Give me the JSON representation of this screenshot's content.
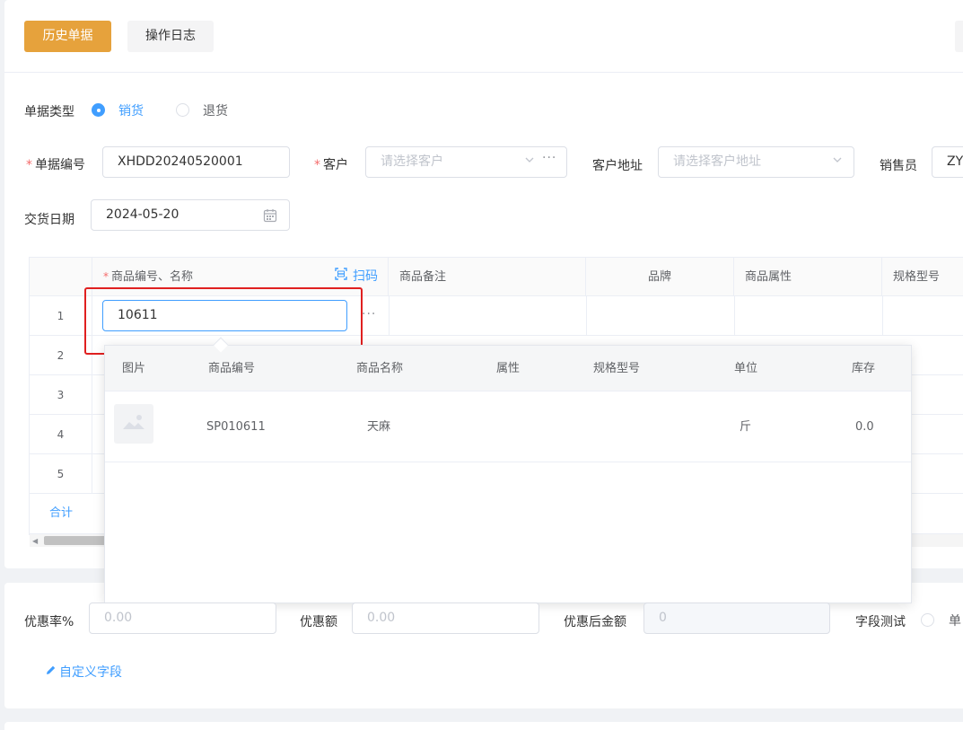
{
  "toolbar": {
    "history_label": "历史单据",
    "log_label": "操作日志"
  },
  "form": {
    "doc_type_label": "单据类型",
    "doc_type_options": [
      "销货",
      "退货"
    ],
    "doc_no_label": "单据编号",
    "doc_no_value": "XHDD20240520001",
    "customer_label": "客户",
    "customer_placeholder": "请选择客户",
    "address_label": "客户地址",
    "address_placeholder": "请选择客户地址",
    "salesman_label": "销售员",
    "salesman_value": "ZY",
    "date_label": "交货日期",
    "date_value": "2024-05-20"
  },
  "table": {
    "columns": [
      "商品编号、名称",
      "商品备注",
      "品牌",
      "商品属性",
      "规格型号"
    ],
    "scan_label": "扫码",
    "row_numbers": [
      "1",
      "2",
      "3",
      "4",
      "5"
    ],
    "sum_label": "合计",
    "active_input_value": "10611"
  },
  "dropdown": {
    "columns": [
      "图片",
      "商品编号",
      "商品名称",
      "属性",
      "规格型号",
      "单位",
      "库存"
    ],
    "rows": [
      {
        "code": "SP010611",
        "name": "天麻",
        "attr": "",
        "spec": "",
        "unit": "斤",
        "stock": "0.0"
      }
    ]
  },
  "discount": {
    "rate_label": "优惠率%",
    "rate_value": "0.00",
    "amount_label": "优惠额",
    "amount_value": "0.00",
    "after_label": "优惠后金额",
    "after_value": "0",
    "test_label": "字段测试",
    "test_option": "单",
    "custom_field_label": "自定义字段"
  },
  "colors": {
    "primary": "#409eff",
    "warning": "#e6a23c",
    "danger": "#f56c6c",
    "highlight": "#e02020"
  }
}
